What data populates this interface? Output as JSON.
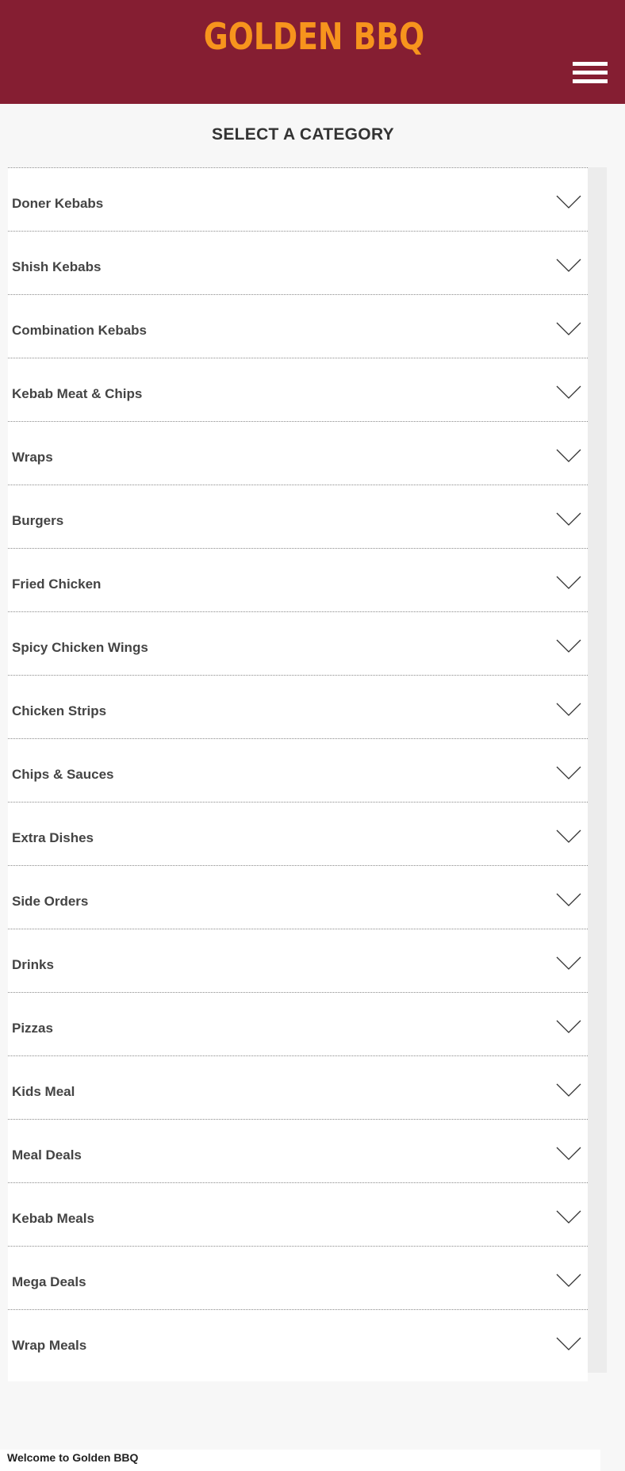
{
  "header": {
    "logo": "GOLDEN BBQ",
    "menu_icon": "hamburger-menu-icon",
    "background_color": "#851e32",
    "logo_color": "#f7941d"
  },
  "section_title": "SELECT A CATEGORY",
  "categories": [
    {
      "label": "Doner Kebabs"
    },
    {
      "label": "Shish Kebabs"
    },
    {
      "label": "Combination Kebabs"
    },
    {
      "label": "Kebab Meat & Chips"
    },
    {
      "label": "Wraps"
    },
    {
      "label": "Burgers"
    },
    {
      "label": "Fried Chicken"
    },
    {
      "label": "Spicy Chicken Wings"
    },
    {
      "label": "Chicken Strips"
    },
    {
      "label": "Chips & Sauces"
    },
    {
      "label": "Extra Dishes"
    },
    {
      "label": "Side Orders"
    },
    {
      "label": "Drinks"
    },
    {
      "label": "Pizzas"
    },
    {
      "label": "Kids Meal"
    },
    {
      "label": "Meal Deals"
    },
    {
      "label": "Kebab Meals"
    },
    {
      "label": "Mega Deals"
    },
    {
      "label": "Wrap Meals"
    }
  ],
  "category_icon": "chevron-down-icon",
  "footer": {
    "welcome": "Welcome to Golden BBQ"
  }
}
